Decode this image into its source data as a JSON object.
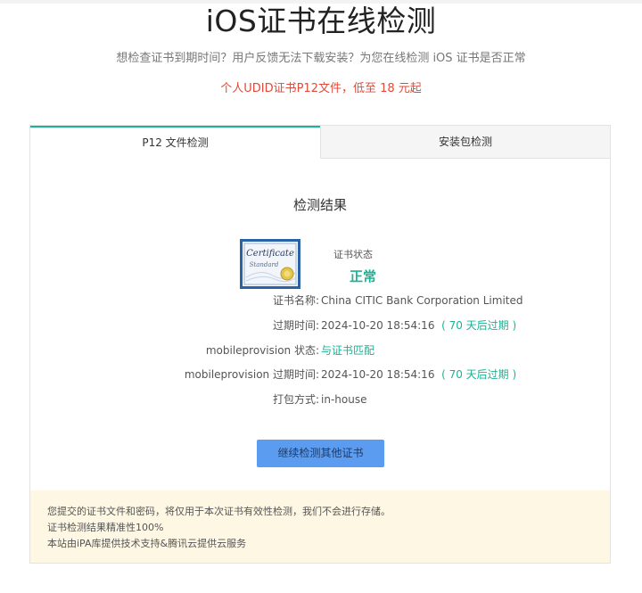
{
  "page": {
    "title": "iOS证书在线检测",
    "subtitle": "想检查证书到期时间？用户反馈无法下载安装？为您在线检测 iOS 证书是否正常",
    "promo": "个人UDID证书P12文件，低至 18 元起"
  },
  "tabs": [
    {
      "label": "P12 文件检测",
      "active": true
    },
    {
      "label": "安装包检测",
      "active": false
    }
  ],
  "result": {
    "title": "检测结果",
    "certificate_image_text": {
      "line1": "Certificate",
      "line2": "Standard"
    },
    "status_label": "证书状态",
    "status_value": "正常",
    "rows": [
      {
        "label": "证书名称:",
        "value": "China CITIC Bank Corporation Limited",
        "note": ""
      },
      {
        "label": "过期时间:",
        "value": "2024-10-20 18:54:16",
        "note": "( 70 天后过期 )"
      },
      {
        "label": "mobileprovision 状态:",
        "value": "",
        "note": "与证书匹配"
      },
      {
        "label": "mobileprovision 过期时间:",
        "value": "2024-10-20 18:54:16",
        "note": "( 70 天后过期 )"
      },
      {
        "label": "打包方式:",
        "value": "in-house",
        "note": ""
      }
    ],
    "continue_button": "继续检测其他证书"
  },
  "notice": {
    "lines": [
      "您提交的证书文件和密码，将仅用于本次证书有效性检测，我们不会进行存储。",
      "证书检测结果精准性100%",
      "本站由iPA库提供技术支持&腾讯云提供云服务"
    ]
  },
  "colors": {
    "accent": "#1ab394",
    "promo": "#e04b3a",
    "button": "#5b9cf0",
    "notice_bg": "#fdf7e3"
  }
}
